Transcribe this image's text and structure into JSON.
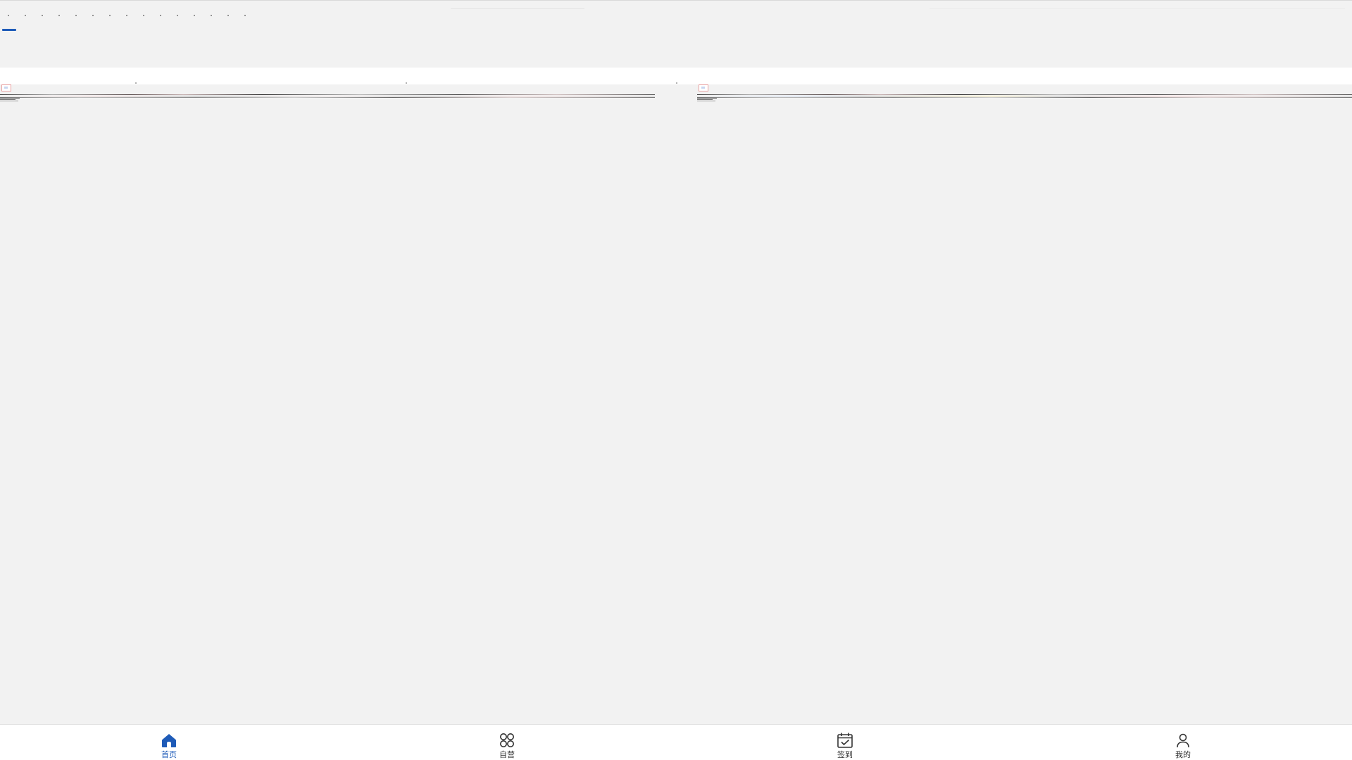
{
  "theme": {
    "background": "#f2f2f2",
    "accent": "#1e5bb8",
    "text": "#333333",
    "bar_background": "#ffffff"
  },
  "category_tabs": {
    "items": [
      {
        "label": ""
      },
      {
        "label": ""
      },
      {
        "label": ""
      },
      {
        "label": ""
      },
      {
        "label": ""
      },
      {
        "label": ""
      },
      {
        "label": ""
      },
      {
        "label": ""
      },
      {
        "label": ""
      },
      {
        "label": ""
      },
      {
        "label": ""
      },
      {
        "label": ""
      },
      {
        "label": ""
      },
      {
        "label": ""
      },
      {
        "label": ""
      }
    ],
    "active_index": 0
  },
  "feed": {
    "cards": [
      {
        "title": ""
      },
      {
        "title": ""
      }
    ]
  },
  "bottom_nav": {
    "items": [
      {
        "label": "首页",
        "icon": "home-icon",
        "active": true
      },
      {
        "label": "自营",
        "icon": "apps-icon",
        "active": false
      },
      {
        "label": "签到",
        "icon": "calendar-check-icon",
        "active": false
      },
      {
        "label": "我的",
        "icon": "user-icon",
        "active": false
      }
    ]
  }
}
